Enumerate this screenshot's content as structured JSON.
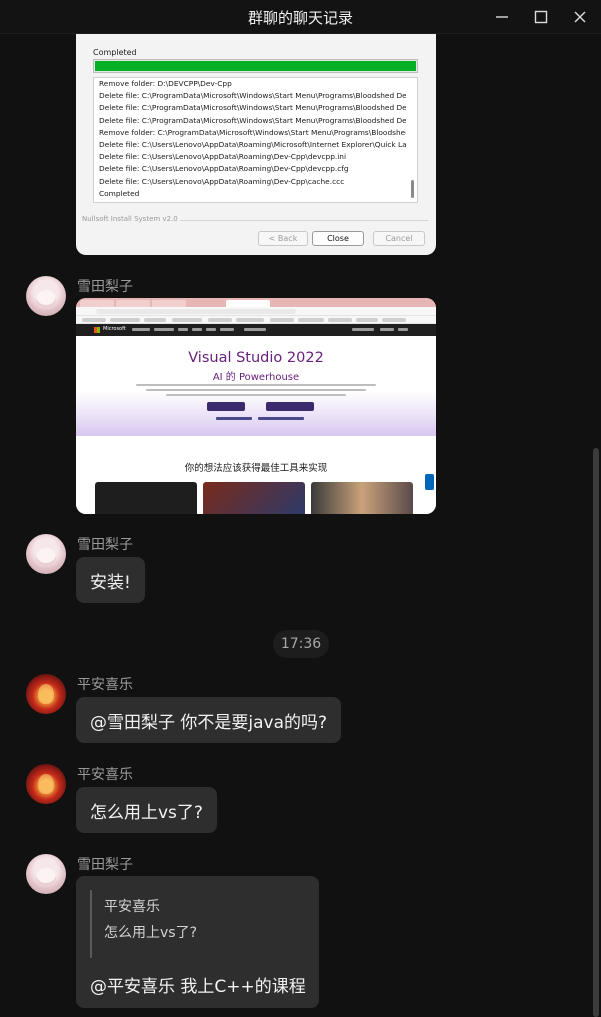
{
  "window": {
    "title": "群聊的聊天记录"
  },
  "installer": {
    "status": "Completed",
    "progress_fraction": 1.0,
    "log_lines": [
      "Remove folder: D:\\DEVCPP\\Dev-Cpp",
      "Delete file: C:\\ProgramData\\Microsoft\\Windows\\Start Menu\\Programs\\Bloodshed Dev...",
      "Delete file: C:\\ProgramData\\Microsoft\\Windows\\Start Menu\\Programs\\Bloodshed Dev...",
      "Delete file: C:\\ProgramData\\Microsoft\\Windows\\Start Menu\\Programs\\Bloodshed Dev...",
      "Remove folder: C:\\ProgramData\\Microsoft\\Windows\\Start Menu\\Programs\\Bloodshed...",
      "Delete file: C:\\Users\\Lenovo\\AppData\\Roaming\\Microsoft\\Internet Explorer\\Quick La...",
      "Delete file: C:\\Users\\Lenovo\\AppData\\Roaming\\Dev-Cpp\\devcpp.ini",
      "Delete file: C:\\Users\\Lenovo\\AppData\\Roaming\\Dev-Cpp\\devcpp.cfg",
      "Delete file: C:\\Users\\Lenovo\\AppData\\Roaming\\Dev-Cpp\\cache.ccc",
      "Completed"
    ],
    "system_label": "Nullsoft Install System v2.0",
    "back_label": "< Back",
    "close_label": "Close",
    "cancel_label": "Cancel"
  },
  "vs_screenshot": {
    "brand": "Microsoft",
    "headline": "Visual Studio 2022",
    "subheadline": "AI 的 Powerhouse",
    "section_title": "你的想法应该获得最佳工具来实现",
    "side_chip": "反馈"
  },
  "messages": [
    {
      "sender": "雪田梨子",
      "avatar": "avatar-snow"
    },
    {
      "sender": "雪田梨子",
      "text": "安装!",
      "avatar": "avatar-snow"
    },
    {
      "sender": "平安喜乐",
      "text": "@雪田梨子 你不是要java的吗?",
      "avatar": "avatar-fire"
    },
    {
      "sender": "平安喜乐",
      "text": "怎么用上vs了?",
      "avatar": "avatar-fire"
    },
    {
      "sender": "雪田梨子",
      "avatar": "avatar-snow",
      "quote_name": "平安喜乐",
      "quote_text": "怎么用上vs了?",
      "text": "@平安喜乐 我上C++的课程"
    }
  ],
  "time_divider": "17:36",
  "colors": {
    "background": "#111111",
    "bubble": "#2e2e2e",
    "progress_green": "#06b025",
    "vs_purple": "#68217a"
  }
}
